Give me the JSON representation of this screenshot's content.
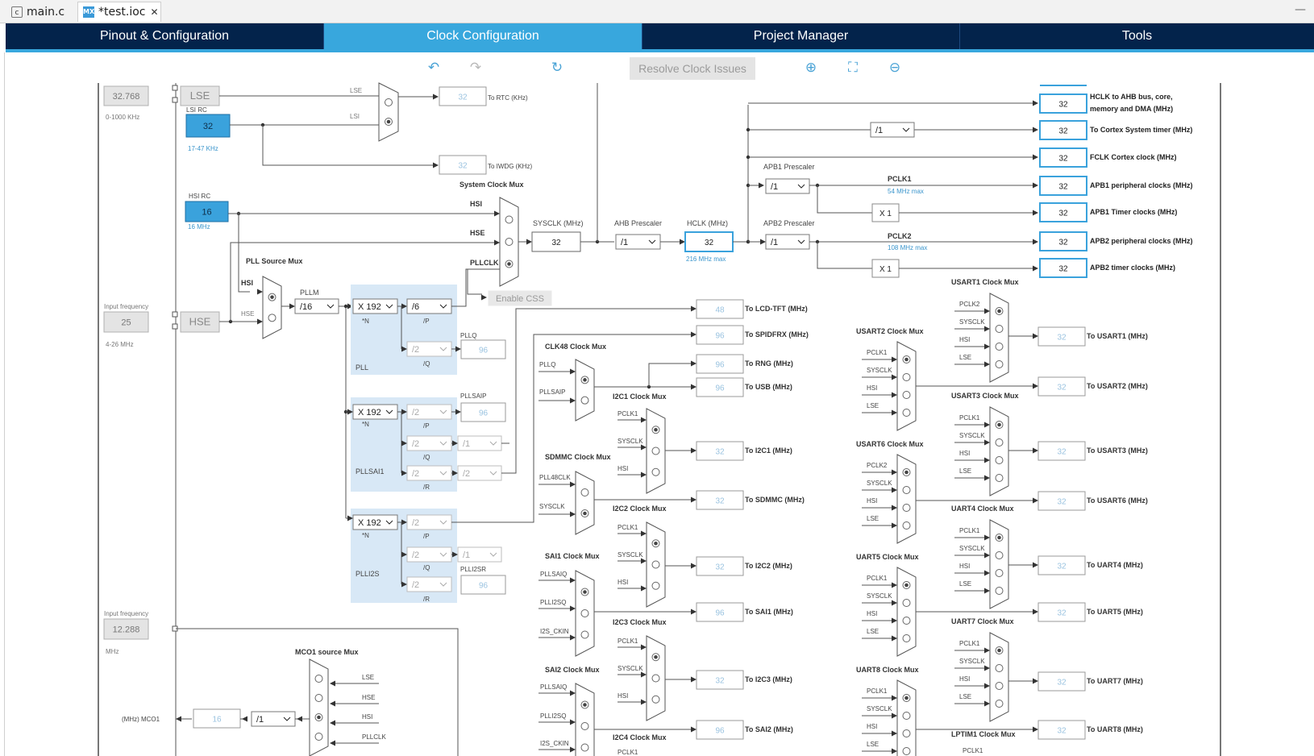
{
  "file_tabs": [
    {
      "label": "main.c",
      "icon": "c-file-icon"
    },
    {
      "label": "*test.ioc",
      "icon": "mx-file-icon"
    }
  ],
  "nav_tabs": [
    "Pinout & Configuration",
    "Clock Configuration",
    "Project Manager",
    "Tools"
  ],
  "toolbar": {
    "resolve_label": "Resolve Clock Issues"
  },
  "oscillators": {
    "lse_value": "32.768",
    "lse_range": "0-1000 KHz",
    "lse_label": "LSE",
    "lsi_label": "LSI RC",
    "lsi_value": "32",
    "lsi_range": "17-47 KHz",
    "hsi_label": "HSI RC",
    "hsi_value": "16",
    "hsi_freq": "16 MHz",
    "hse_input_label": "Input frequency",
    "hse_value": "25",
    "hse_range": "4-26 MHz",
    "hse_label": "HSE",
    "i2s_input_label": "Input frequency",
    "i2s_value": "12.288",
    "i2s_unit": "MHz"
  },
  "rtc": {
    "lse_line": "LSE",
    "lsi_line": "LSI",
    "rtc_value": "32",
    "rtc_label": "To RTC (KHz)",
    "iwdg_value": "32",
    "iwdg_label": "To IWDG (KHz)"
  },
  "sysclk_mux": {
    "title": "System Clock Mux",
    "hsi": "HSI",
    "hse": "HSE",
    "pllclk": "PLLCLK",
    "enable_css": "Enable CSS"
  },
  "pll_source": {
    "title": "PLL Source Mux",
    "hsi": "HSI",
    "hse": "HSE"
  },
  "pllm": {
    "label": "PLLM",
    "value": "/16"
  },
  "pll": {
    "n": "X 192",
    "n_lbl": "*N",
    "p": "/6",
    "p_lbl": "/P",
    "q": "/2",
    "q_lbl": "/Q",
    "pllq_lbl": "PLLQ",
    "pllq_val": "96",
    "name": "PLL"
  },
  "pllsai": {
    "n": "X 192",
    "n_lbl": "*N",
    "p": "/2",
    "p_lbl": "/P",
    "pllsaip_lbl": "PLLSAIP",
    "pllsaip_val": "96",
    "q": "/2",
    "q_lbl": "/Q",
    "q_div": "/1",
    "r": "/2",
    "r_lbl": "/R",
    "r_div": "/2",
    "name": "PLLSAI1"
  },
  "plli2s": {
    "n": "X 192",
    "n_lbl": "*N",
    "p": "/2",
    "p_lbl": "/P",
    "q": "/2",
    "q_lbl": "/Q",
    "q_div": "/1",
    "r": "/2",
    "r_lbl": "/R",
    "plli2sr_lbl": "PLLI2SR",
    "plli2sr_val": "96",
    "name": "PLLI2S"
  },
  "sysclk": {
    "label": "SYSCLK (MHz)",
    "value": "32"
  },
  "ahb": {
    "label": "AHB Prescaler",
    "value": "/1"
  },
  "hclk": {
    "label": "HCLK (MHz)",
    "value": "32",
    "max": "216 MHz max"
  },
  "cortex_div": "/1",
  "apb1": {
    "label": "APB1 Prescaler",
    "value": "/1",
    "pclk": "PCLK1",
    "max": "54 MHz max",
    "timer_mult": "X 1"
  },
  "apb2": {
    "label": "APB2 Prescaler",
    "value": "/1",
    "pclk": "PCLK2",
    "max": "108 MHz max",
    "timer_mult": "X 1"
  },
  "outputs": [
    {
      "value": "32",
      "label": "HCLK to AHB bus, core,"
    },
    {
      "value": "32",
      "label": "To Cortex System timer (MHz)"
    },
    {
      "value": "32",
      "label": "FCLK Cortex clock (MHz)"
    },
    {
      "value": "32",
      "label": "APB1 peripheral clocks (MHz)"
    },
    {
      "value": "32",
      "label": "APB1 Timer clocks (MHz)"
    },
    {
      "value": "32",
      "label": "APB2 peripheral clocks (MHz)"
    },
    {
      "value": "32",
      "label": "APB2 timer clocks (MHz)"
    }
  ],
  "hclk_output_sub": "memory and DMA (MHz)",
  "mid_outputs": [
    {
      "value": "48",
      "label": "To LCD-TFT (MHz)"
    },
    {
      "value": "96",
      "label": "To SPIDFRX (MHz)"
    },
    {
      "value": "96",
      "label": "To RNG (MHz)"
    },
    {
      "value": "96",
      "label": "To USB (MHz)"
    },
    {
      "value": "32",
      "label": "To I2C1 (MHz)"
    },
    {
      "value": "32",
      "label": "To SDMMC (MHz)"
    },
    {
      "value": "32",
      "label": "To I2C2 (MHz)"
    },
    {
      "value": "96",
      "label": "To SAI1 (MHz)"
    },
    {
      "value": "32",
      "label": "To I2C3 (MHz)"
    },
    {
      "value": "96",
      "label": "To SAI2 (MHz)"
    }
  ],
  "mux_titles": {
    "clk48": "CLK48 Clock Mux",
    "i2c1": "I2C1 Clock Mux",
    "sdmmc": "SDMMC Clock Mux",
    "i2c2": "I2C2 Clock Mux",
    "sai1": "SAI1 Clock Mux",
    "i2c3": "I2C3 Clock Mux",
    "sai2": "SAI2 Clock Mux",
    "i2c4": "I2C4 Clock Mux",
    "mco1": "MCO1 source Mux",
    "usart1": "USART1 Clock Mux",
    "usart2": "USART2 Clock Mux",
    "usart3": "USART3 Clock Mux",
    "usart6": "USART6 Clock Mux",
    "uart4": "UART4 Clock Mux",
    "uart5": "UART5 Clock Mux",
    "uart7": "UART7 Clock Mux",
    "uart8": "UART8 Clock Mux",
    "lptim1": "LPTIM1 Clock Mux"
  },
  "mux_inputs": {
    "clk48": [
      "PLLQ",
      "PLLSAIP"
    ],
    "sdmmc": [
      "PLL48CLK",
      "SYSCLK"
    ],
    "sai": [
      "PLLSAIQ",
      "PLLI2SQ",
      "I2S_CKIN"
    ],
    "i2c": [
      "PCLK1",
      "SYSCLK",
      "HSI"
    ],
    "usart_apb2": [
      "PCLK2",
      "SYSCLK",
      "HSI",
      "LSE"
    ],
    "usart_apb1": [
      "PCLK1",
      "SYSCLK",
      "HSI",
      "LSE"
    ],
    "mco1": [
      "LSE",
      "HSE",
      "HSI",
      "PLLCLK"
    ],
    "lptim_first": "PCLK1"
  },
  "uart_outputs": [
    {
      "value": "32",
      "label": "To USART1 (MHz)"
    },
    {
      "value": "32",
      "label": "To USART2 (MHz)"
    },
    {
      "value": "32",
      "label": "To USART3 (MHz)"
    },
    {
      "value": "32",
      "label": "To USART6 (MHz)"
    },
    {
      "value": "32",
      "label": "To UART4 (MHz)"
    },
    {
      "value": "32",
      "label": "To UART5 (MHz)"
    },
    {
      "value": "32",
      "label": "To UART7 (MHz)"
    },
    {
      "value": "32",
      "label": "To UART8 (MHz)"
    }
  ],
  "mco1": {
    "label": "(MHz) MCO1",
    "value": "16",
    "div": "/1"
  }
}
